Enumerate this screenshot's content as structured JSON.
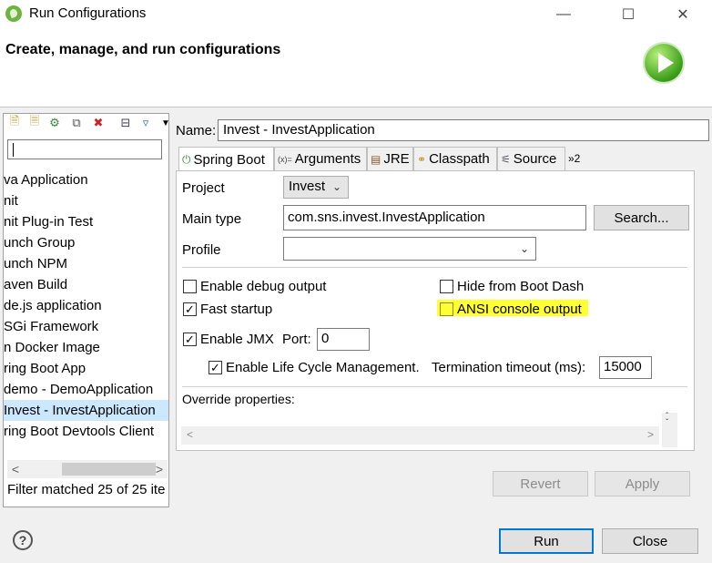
{
  "window": {
    "title": "Run Configurations",
    "minimize_icon": "minimize-icon",
    "maximize_icon": "maximize-icon",
    "close_icon": "close-icon"
  },
  "header": {
    "title": "Create, manage, and run configurations"
  },
  "left": {
    "toolbar": [
      "new-config-icon",
      "new-prototype-icon",
      "export-icon",
      "duplicate-icon",
      "delete-icon",
      "collapse-all-icon",
      "filter-icon",
      "view-menu-icon"
    ],
    "filter_value": "",
    "items": [
      "va Application",
      "nit",
      "nit Plug-in Test",
      "unch Group",
      "unch NPM",
      "aven Build",
      "de.js application",
      "SGi Framework",
      "n Docker Image",
      "ring Boot App",
      "demo - DemoApplication",
      "Invest - InvestApplication",
      "ring Boot Devtools Client"
    ],
    "selected_index": 11,
    "scroll_left": "<",
    "scroll_right": ">",
    "status": "Filter matched 25 of 25 ite"
  },
  "right": {
    "name_label": "Name:",
    "name_value": "Invest - InvestApplication",
    "tabs": [
      {
        "label": "Spring Boot",
        "icon": "spring-boot-icon",
        "glyph": "⏻"
      },
      {
        "label": "Arguments",
        "icon": "arguments-icon",
        "glyph": "(x)="
      },
      {
        "label": "JRE",
        "icon": "jre-icon",
        "glyph": "▤"
      },
      {
        "label": "Classpath",
        "icon": "classpath-icon",
        "glyph": "⚭"
      },
      {
        "label": "Source",
        "icon": "source-icon",
        "glyph": "⚟"
      },
      {
        "label": "»2",
        "icon": "more-tabs-icon",
        "glyph": ""
      }
    ],
    "project_label": "Project",
    "project_value": "Invest",
    "main_type_label": "Main type",
    "main_type_value": "com.sns.invest.InvestApplication",
    "search_button": "Search...",
    "profile_label": "Profile",
    "profile_value": "",
    "enable_debug": {
      "label": "Enable debug output",
      "checked": false
    },
    "hide_boot_dash": {
      "label": "Hide from Boot Dash",
      "checked": false
    },
    "fast_startup": {
      "label": "Fast startup",
      "checked": true
    },
    "ansi_console": {
      "label": "ANSI console output",
      "checked": false
    },
    "enable_jmx": {
      "label": "Enable JMX",
      "checked": true
    },
    "port_label": "Port:",
    "port_value": "0",
    "lifecycle": {
      "label": "Enable Life Cycle Management.",
      "checked": true
    },
    "termination_label": "Termination timeout (ms):",
    "termination_value": "15000",
    "override_label": "Override properties:",
    "revert_button": "Revert",
    "apply_button": "Apply"
  },
  "footer": {
    "run_button": "Run",
    "close_button": "Close",
    "help_icon": "help-icon"
  },
  "colors": {
    "selection": "#cce8ff",
    "highlight": "#ffff33",
    "accent": "#0078d7"
  }
}
